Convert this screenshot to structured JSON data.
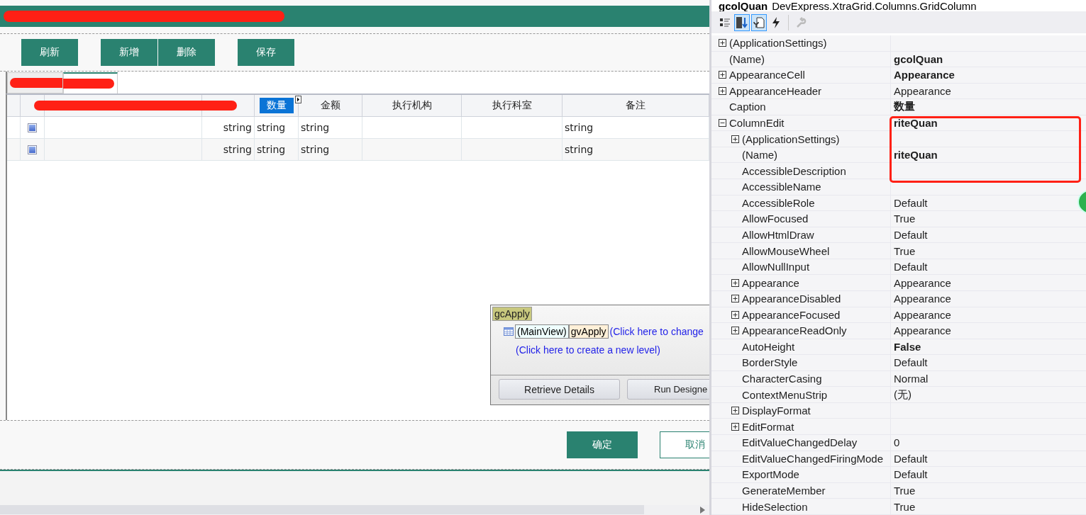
{
  "toolbar": {
    "buttons": [
      "刷新",
      "新增",
      "删除",
      "保存"
    ]
  },
  "tabs": [
    {
      "selected": false
    },
    {
      "selected": true
    }
  ],
  "grid": {
    "columns": [
      {
        "kind": "indicator",
        "selected": false
      },
      {
        "kind": "check",
        "selected": false
      },
      {
        "kind": "text",
        "selected": false
      },
      {
        "kind": "number",
        "selected": false
      },
      {
        "kind": "text",
        "label": "数量",
        "selected": true
      },
      {
        "kind": "text",
        "label": "金额",
        "selected": false
      },
      {
        "kind": "text",
        "label": "执行机构",
        "selected": false
      },
      {
        "kind": "text",
        "label": "执行科室",
        "selected": false
      },
      {
        "kind": "text",
        "label": "备注",
        "selected": false
      }
    ],
    "rows": [
      {
        "cells": [
          null,
          null,
          null,
          "string",
          "string",
          "string",
          null,
          null,
          "string"
        ]
      },
      {
        "cells": [
          null,
          null,
          null,
          "string",
          "string",
          "string",
          null,
          null,
          "string"
        ]
      }
    ]
  },
  "designer": {
    "grid_name": "gcApply",
    "view_label": "(MainView)",
    "view_name": "gvApply",
    "change_link": "(Click here to change",
    "new_level_link": "(Click here to create a new level)",
    "buttons": [
      "Retrieve Details",
      "Run Designe"
    ]
  },
  "footer": {
    "buttons": [
      {
        "label": "确定",
        "kind": "primary"
      },
      {
        "label": "取消",
        "kind": "secondary"
      }
    ]
  },
  "properties": {
    "object_name": "gcolQuan",
    "object_type": "DevExpress.XtraGrid.Columns.GridColumn",
    "toolbar": [
      {
        "kind": "categorized",
        "selected": false
      },
      {
        "kind": "alphabetical",
        "selected": true
      },
      {
        "kind": "properties",
        "selected": true
      },
      {
        "kind": "events",
        "selected": false
      },
      {
        "kind": "pages",
        "selected": false
      }
    ],
    "rows": [
      {
        "name": "(ApplicationSettings)",
        "expanded": false
      },
      {
        "name": "(Name)",
        "value": "gcolQuan",
        "bold": true
      },
      {
        "name": "AppearanceCell",
        "value": "Appearance",
        "bold": true,
        "expanded": false
      },
      {
        "name": "AppearanceHeader",
        "value": "Appearance",
        "bold": false,
        "expanded": false
      },
      {
        "name": "Caption",
        "value": "数量",
        "bold": true
      },
      {
        "name": "ColumnEdit",
        "value": "riteQuan",
        "bold": true,
        "expanded": true,
        "children": [
          {
            "name": "(ApplicationSettings)",
            "expanded": false
          },
          {
            "name": "(Name)",
            "value": "riteQuan",
            "bold": true
          },
          {
            "name": "AccessibleDescription"
          },
          {
            "name": "AccessibleName"
          },
          {
            "name": "AccessibleRole",
            "value": "Default",
            "bold": false
          },
          {
            "name": "AllowFocused",
            "value": "True",
            "bold": false
          },
          {
            "name": "AllowHtmlDraw",
            "value": "Default",
            "bold": false
          },
          {
            "name": "AllowMouseWheel",
            "value": "True",
            "bold": false
          },
          {
            "name": "AllowNullInput",
            "value": "Default",
            "bold": false
          },
          {
            "name": "Appearance",
            "value": "Appearance",
            "bold": false,
            "expanded": false
          },
          {
            "name": "AppearanceDisabled",
            "value": "Appearance",
            "bold": false,
            "expanded": false
          },
          {
            "name": "AppearanceFocused",
            "value": "Appearance",
            "bold": false,
            "expanded": false
          },
          {
            "name": "AppearanceReadOnly",
            "value": "Appearance",
            "bold": false,
            "expanded": false
          },
          {
            "name": "AutoHeight",
            "value": "False",
            "bold": true
          },
          {
            "name": "BorderStyle",
            "value": "Default",
            "bold": false
          },
          {
            "name": "CharacterCasing",
            "value": "Normal",
            "bold": false
          },
          {
            "name": "ContextMenuStrip",
            "value": "(无)",
            "bold": false
          },
          {
            "name": "DisplayFormat",
            "expanded": false
          },
          {
            "name": "EditFormat",
            "expanded": false
          },
          {
            "name": "EditValueChangedDelay",
            "value": "0",
            "bold": false
          },
          {
            "name": "EditValueChangedFiringMode",
            "value": "Default",
            "bold": false
          },
          {
            "name": "ExportMode",
            "value": "Default",
            "bold": false
          },
          {
            "name": "GenerateMember",
            "value": "True",
            "bold": false
          },
          {
            "name": "HideSelection",
            "value": "True",
            "bold": false
          }
        ]
      }
    ]
  }
}
